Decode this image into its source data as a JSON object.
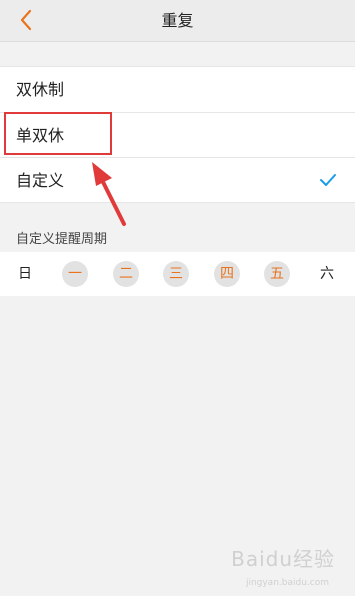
{
  "header": {
    "title": "重复",
    "back_icon": "chevron-left-icon",
    "accent_color": "#e8741e"
  },
  "options": [
    {
      "label": "双休制",
      "checked": false
    },
    {
      "label": "单双休",
      "checked": false
    },
    {
      "label": "自定义",
      "checked": true
    }
  ],
  "check_color": "#1a9be8",
  "custom": {
    "section_label": "自定义提醒周期",
    "days": [
      {
        "label": "日",
        "selected": false
      },
      {
        "label": "一",
        "selected": true
      },
      {
        "label": "二",
        "selected": true
      },
      {
        "label": "三",
        "selected": true
      },
      {
        "label": "四",
        "selected": true
      },
      {
        "label": "五",
        "selected": true
      },
      {
        "label": "六",
        "selected": false
      }
    ]
  },
  "annotation": {
    "highlight_color": "#e03a3a"
  },
  "watermark": {
    "text": "Baidu经验",
    "sub": "jingyan.baidu.com"
  }
}
